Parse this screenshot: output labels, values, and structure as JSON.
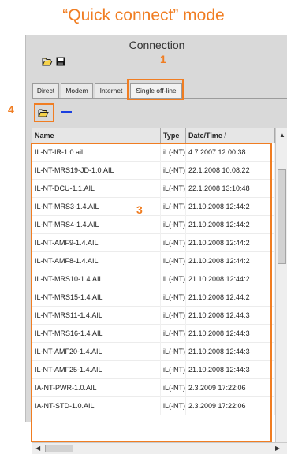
{
  "heading": "“Quick connect” mode",
  "panel": {
    "title": "Connection"
  },
  "tabs": [
    {
      "label": "Direct"
    },
    {
      "label": "Modem"
    },
    {
      "label": "Internet"
    },
    {
      "label": "Single off-line"
    }
  ],
  "selected_tab": "Single off-line",
  "callouts": [
    "1",
    "3",
    "4"
  ],
  "icons": {
    "open": "folder-open-icon",
    "save": "floppy-disk-icon",
    "browse": "folder-open-icon",
    "remove": "minus-icon"
  },
  "colors": {
    "accent": "#f07d22",
    "remove": "#1a3fe0"
  },
  "table": {
    "columns": [
      "Name",
      "Type",
      "Date/Time /"
    ],
    "rows": [
      [
        "IL-NT-IR-1.0.ail",
        "iL(-NT)",
        "4.7.2007 12:00:38"
      ],
      [
        "IL-NT-MRS19-JD-1.0.AIL",
        "iL(-NT)",
        "22.1.2008 10:08:22"
      ],
      [
        "IL-NT-DCU-1.1.AIL",
        "iL(-NT)",
        "22.1.2008 13:10:48"
      ],
      [
        "IL-NT-MRS3-1.4.AIL",
        "iL(-NT)",
        "21.10.2008 12:44:2"
      ],
      [
        "IL-NT-MRS4-1.4.AIL",
        "iL(-NT)",
        "21.10.2008 12:44:2"
      ],
      [
        "IL-NT-AMF9-1.4.AIL",
        "iL(-NT)",
        "21.10.2008 12:44:2"
      ],
      [
        "IL-NT-AMF8-1.4.AIL",
        "iL(-NT)",
        "21.10.2008 12:44:2"
      ],
      [
        "IL-NT-MRS10-1.4.AIL",
        "iL(-NT)",
        "21.10.2008 12:44:2"
      ],
      [
        "IL-NT-MRS15-1.4.AIL",
        "iL(-NT)",
        "21.10.2008 12:44:2"
      ],
      [
        "IL-NT-MRS11-1.4.AIL",
        "iL(-NT)",
        "21.10.2008 12:44:3"
      ],
      [
        "IL-NT-MRS16-1.4.AIL",
        "iL(-NT)",
        "21.10.2008 12:44:3"
      ],
      [
        "IL-NT-AMF20-1.4.AIL",
        "iL(-NT)",
        "21.10.2008 12:44:3"
      ],
      [
        "IL-NT-AMF25-1.4.AIL",
        "iL(-NT)",
        "21.10.2008 12:44:3"
      ],
      [
        "IA-NT-PWR-1.0.AIL",
        "iL(-NT)",
        "2.3.2009 17:22:06"
      ],
      [
        "IA-NT-STD-1.0.AIL",
        "iL(-NT)",
        "2.3.2009 17:22:06"
      ]
    ]
  }
}
